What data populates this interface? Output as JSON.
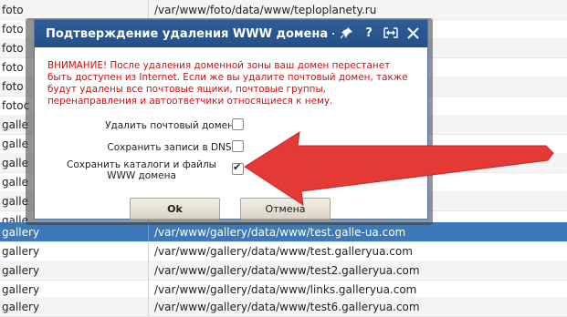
{
  "rows": [
    {
      "name": "foto",
      "path": "/var/www/foto/data/www/teploplanety.ru"
    },
    {
      "name": "foto",
      "path": ""
    },
    {
      "name": "foto",
      "path": ""
    },
    {
      "name": "foto",
      "path": ""
    },
    {
      "name": "foto",
      "path": ""
    },
    {
      "name": "fotoc",
      "path": ""
    },
    {
      "name": "galle",
      "path": ""
    },
    {
      "name": "galle",
      "path": ""
    },
    {
      "name": "galle",
      "path": ""
    },
    {
      "name": "galle",
      "path": ""
    },
    {
      "name": "galle",
      "path": ""
    },
    {
      "name": "galle",
      "path": ""
    },
    {
      "name": "gallery",
      "path": "/var/www/gallery/data/www/test.galle-ua.com"
    },
    {
      "name": "gallery",
      "path": "/var/www/gallery/data/www/test.galleryua.com"
    },
    {
      "name": "gallery",
      "path": "/var/www/gallery/data/www/test2.galleryua.com"
    },
    {
      "name": "gallery",
      "path": "/var/www/gallery/data/www/links.galleryua.com"
    },
    {
      "name": "gallery",
      "path": "/var/www/gallery/data/www/test6.galleryua.com"
    }
  ],
  "dialog": {
    "title": "Подтверждение удаления WWW домена - test.c",
    "warning": "ВНИМАНИЕ! После удаления доменной зоны ваш домен перестанет быть доступен из Internet. Если же вы удалите почтовый домен, также будут удалены все почтовые ящики, почтовые группы, перенаправления и автоответчики относящиеся к нему.",
    "options": [
      {
        "label": "Удалить почтовый домен",
        "checked": false
      },
      {
        "label": "Сохранить записи в DNS",
        "checked": false
      },
      {
        "label": "Сохранить каталоги и файлы WWW домена",
        "checked": true
      }
    ],
    "ok_label": "Ok",
    "cancel_label": "Отмена",
    "title_icons": [
      "pin-icon",
      "help-icon",
      "resize-icon",
      "close-icon"
    ]
  },
  "colors": {
    "selected_row": "#3d78b8",
    "title_bar": "#2f5d96",
    "warning_text": "#cc1111",
    "arrow": "#e53935"
  }
}
